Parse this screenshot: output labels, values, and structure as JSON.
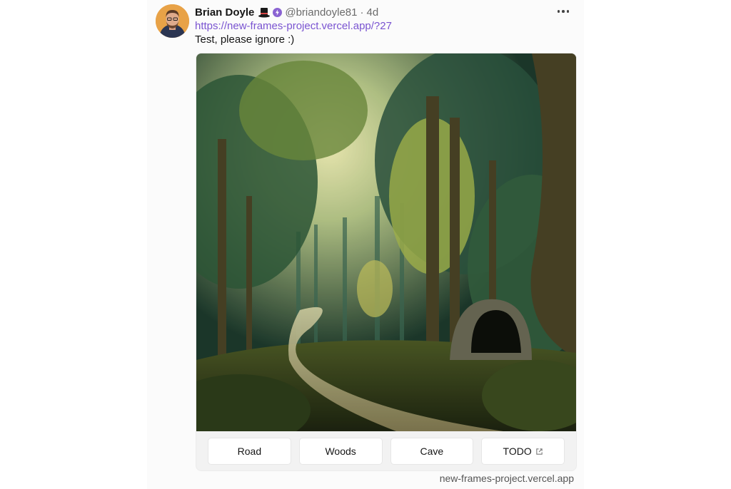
{
  "cast": {
    "author": {
      "display_name": "Brian Doyle",
      "username": "@briandoyle81",
      "avatar_icon": "avatar-photo",
      "emoji_icon": "top-hat-icon",
      "badge_icon": "power-badge-icon"
    },
    "separator": "·",
    "time": "4d",
    "link": "https://new-frames-project.vercel.app/?27",
    "text": "Test, please ignore :)",
    "more_icon": "more-horizontal-icon"
  },
  "frame": {
    "image_description_icon": "forest-road-painting",
    "buttons": [
      {
        "label": "Road"
      },
      {
        "label": "Woods"
      },
      {
        "label": "Cave"
      },
      {
        "label": "TODO",
        "icon": "external-link-icon"
      }
    ],
    "domain": "new-frames-project.vercel.app"
  },
  "colors": {
    "link": "#7a54d1",
    "text": "#161616",
    "muted": "#6b6b6b",
    "badge": "#8a63d2"
  }
}
